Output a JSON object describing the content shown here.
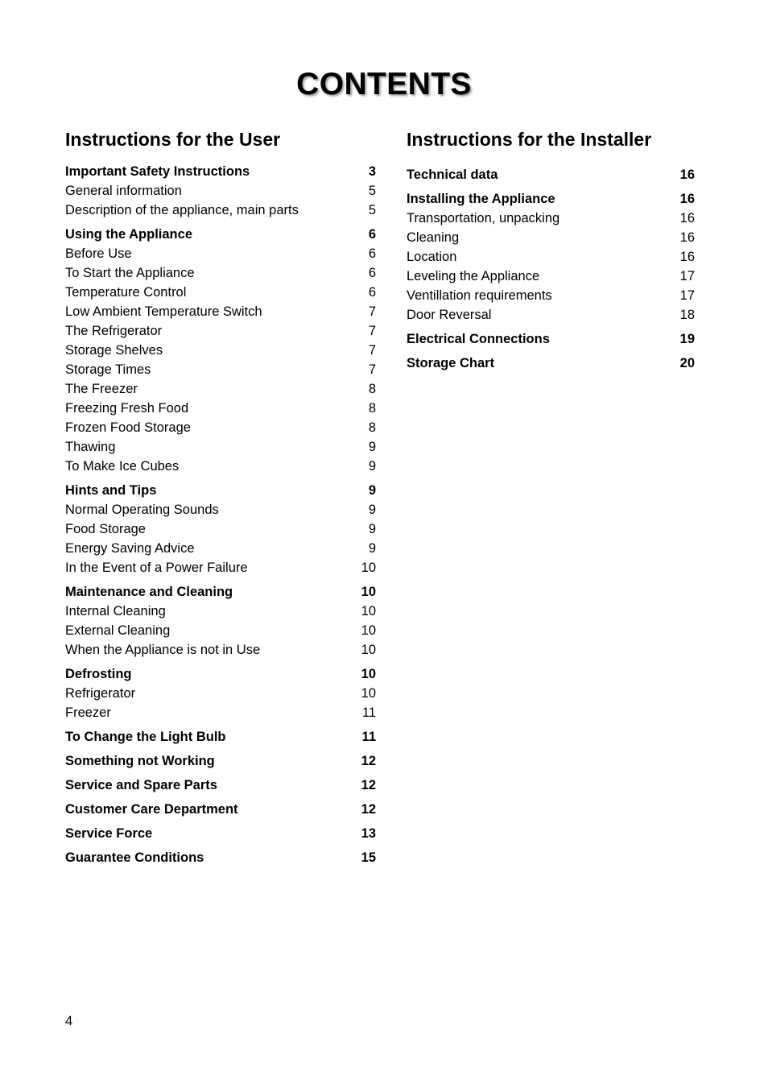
{
  "document": {
    "title": "CONTENTS",
    "page_number": "4"
  },
  "columns": [
    {
      "heading": "Instructions for the User",
      "groups": [
        {
          "entries": [
            {
              "label": "Important Safety Instructions",
              "page": "3",
              "section": true
            },
            {
              "label": "General information",
              "page": "5",
              "section": false
            },
            {
              "label": "Description of the appliance, main parts",
              "page": "5",
              "section": false
            }
          ]
        },
        {
          "entries": [
            {
              "label": "Using the Appliance",
              "page": "6",
              "section": true
            },
            {
              "label": "Before Use",
              "page": "6",
              "section": false
            },
            {
              "label": "To Start the Appliance",
              "page": "6",
              "section": false
            },
            {
              "label": "Temperature Control",
              "page": "6",
              "section": false
            },
            {
              "label": "Low Ambient Temperature Switch",
              "page": "7",
              "section": false
            },
            {
              "label": "The Refrigerator",
              "page": "7",
              "section": false
            },
            {
              "label": "Storage Shelves",
              "page": "7",
              "section": false
            },
            {
              "label": "Storage Times",
              "page": "7",
              "section": false
            },
            {
              "label": "The Freezer",
              "page": "8",
              "section": false
            },
            {
              "label": "Freezing Fresh Food",
              "page": "8",
              "section": false
            },
            {
              "label": "Frozen Food Storage",
              "page": "8",
              "section": false
            },
            {
              "label": "Thawing",
              "page": "9",
              "section": false
            },
            {
              "label": "To Make Ice Cubes",
              "page": "9",
              "section": false
            }
          ]
        },
        {
          "entries": [
            {
              "label": "Hints and Tips",
              "page": "9",
              "section": true
            },
            {
              "label": "Normal Operating Sounds",
              "page": "9",
              "section": false
            },
            {
              "label": "Food Storage",
              "page": "9",
              "section": false
            },
            {
              "label": "Energy Saving Advice",
              "page": "9",
              "section": false
            },
            {
              "label": "In the Event of a Power Failure",
              "page": "10",
              "section": false
            }
          ]
        },
        {
          "entries": [
            {
              "label": "Maintenance and Cleaning",
              "page": "10",
              "section": true
            },
            {
              "label": "Internal Cleaning",
              "page": "10",
              "section": false
            },
            {
              "label": "External Cleaning",
              "page": "10",
              "section": false
            },
            {
              "label": "When the Appliance is not in Use",
              "page": "10",
              "section": false
            }
          ]
        },
        {
          "entries": [
            {
              "label": "Defrosting",
              "page": "10",
              "section": true
            },
            {
              "label": "Refrigerator",
              "page": "10",
              "section": false
            },
            {
              "label": "Freezer",
              "page": "11",
              "section": false
            }
          ]
        },
        {
          "entries": [
            {
              "label": "To Change the Light Bulb",
              "page": "11",
              "section": true
            }
          ]
        },
        {
          "entries": [
            {
              "label": "Something not Working",
              "page": "12",
              "section": true
            }
          ]
        },
        {
          "entries": [
            {
              "label": "Service and Spare Parts",
              "page": "12",
              "section": true
            }
          ]
        },
        {
          "entries": [
            {
              "label": "Customer Care Department",
              "page": "12",
              "section": true
            }
          ]
        },
        {
          "entries": [
            {
              "label": "Service Force",
              "page": "13",
              "section": true
            }
          ]
        },
        {
          "entries": [
            {
              "label": "Guarantee Conditions",
              "page": "15",
              "section": true
            }
          ]
        }
      ]
    },
    {
      "heading": "Instructions for the Installer",
      "groups": [
        {
          "entries": [
            {
              "label": "Technical data",
              "page": "16",
              "section": true
            }
          ]
        },
        {
          "entries": [
            {
              "label": "Installing the Appliance",
              "page": "16",
              "section": true
            },
            {
              "label": "Transportation, unpacking",
              "page": "16",
              "section": false
            },
            {
              "label": "Cleaning",
              "page": "16",
              "section": false
            },
            {
              "label": "Location",
              "page": "16",
              "section": false
            },
            {
              "label": "Leveling the Appliance",
              "page": "17",
              "section": false
            },
            {
              "label": "Ventillation requirements",
              "page": "17",
              "section": false
            },
            {
              "label": "Door Reversal",
              "page": "18",
              "section": false
            }
          ]
        },
        {
          "entries": [
            {
              "label": "Electrical Connections",
              "page": "19",
              "section": true
            }
          ]
        },
        {
          "entries": [
            {
              "label": "Storage Chart",
              "page": "20",
              "section": true
            }
          ]
        }
      ]
    }
  ]
}
